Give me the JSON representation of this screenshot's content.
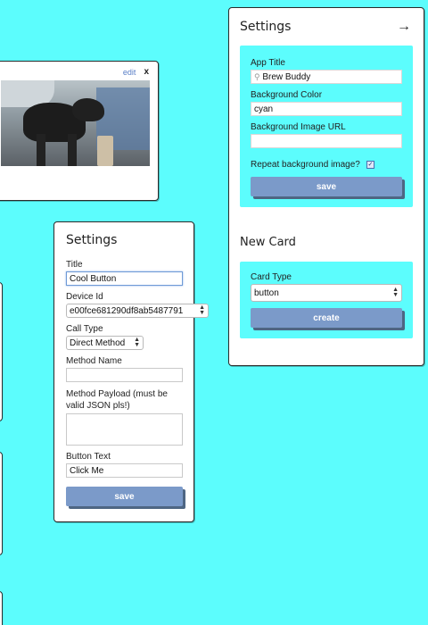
{
  "image_card": {
    "edit_label": "edit",
    "close_label": "x"
  },
  "button_settings": {
    "title": "Settings",
    "fields": {
      "title_label": "Title",
      "title_value": "Cool Button",
      "device_label": "Device Id",
      "device_value": "e00fce681290df8ab5487791",
      "call_type_label": "Call Type",
      "call_type_value": "Direct Method",
      "method_name_label": "Method Name",
      "method_name_value": "",
      "payload_label": "Method Payload (must be valid JSON pls!)",
      "payload_value": "",
      "button_text_label": "Button Text",
      "button_text_value": "Click Me"
    },
    "save_label": "save"
  },
  "app_settings": {
    "title": "Settings",
    "collapse_icon": "right-arrow-icon",
    "app_title_label": "App Title",
    "app_title_value": "Brew Buddy",
    "bg_color_label": "Background Color",
    "bg_color_value": "cyan",
    "bg_image_label": "Background Image URL",
    "bg_image_value": "",
    "repeat_label": "Repeat background image?",
    "repeat_checked": true,
    "save_label": "save"
  },
  "new_card": {
    "title": "New Card",
    "card_type_label": "Card Type",
    "card_type_value": "button",
    "create_label": "create"
  },
  "colors": {
    "background": "#5cfdfd",
    "button": "#7b9ac9",
    "button_shadow": "#4e6683",
    "focus": "#6f9ad6"
  }
}
